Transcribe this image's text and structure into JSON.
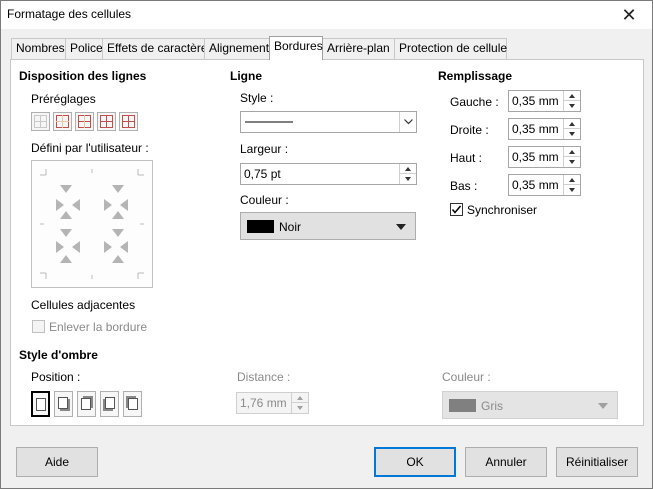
{
  "window": {
    "title": "Formatage des cellules"
  },
  "tabs": [
    {
      "label": "Nombres"
    },
    {
      "label": "Police"
    },
    {
      "label": "Effets de caractère"
    },
    {
      "label": "Alignement"
    },
    {
      "label": "Bordures"
    },
    {
      "label": "Arrière-plan"
    },
    {
      "label": "Protection de cellule"
    }
  ],
  "disposition": {
    "title": "Disposition des lignes",
    "presets_label": "Préréglages",
    "user_defined_label": "Défini par l'utilisateur :",
    "adjacent_label": "Cellules adjacentes",
    "remove_border_label": "Enlever la bordure",
    "remove_border_checked": false
  },
  "ligne": {
    "title": "Ligne",
    "style_label": "Style :",
    "width_label": "Largeur :",
    "width_value": "0,75 pt",
    "color_label": "Couleur :",
    "color_name": "Noir",
    "color_hex": "#000000"
  },
  "remplissage": {
    "title": "Remplissage",
    "left_label": "Gauche :",
    "left_value": "0,35 mm",
    "right_label": "Droite :",
    "right_value": "0,35 mm",
    "top_label": "Haut :",
    "top_value": "0,35 mm",
    "bottom_label": "Bas :",
    "bottom_value": "0,35 mm",
    "sync_label": "Synchroniser",
    "sync_checked": true
  },
  "ombre": {
    "title": "Style d'ombre",
    "position_label": "Position :",
    "distance_label": "Distance :",
    "distance_value": "1,76 mm",
    "color_label": "Couleur :",
    "color_name": "Gris",
    "color_hex": "#808080"
  },
  "buttons": {
    "help": "Aide",
    "ok": "OK",
    "cancel": "Annuler",
    "reset": "Réinitialiser"
  },
  "colors": {
    "accent": "#0078d7",
    "preset_orange": "#c0504d"
  }
}
